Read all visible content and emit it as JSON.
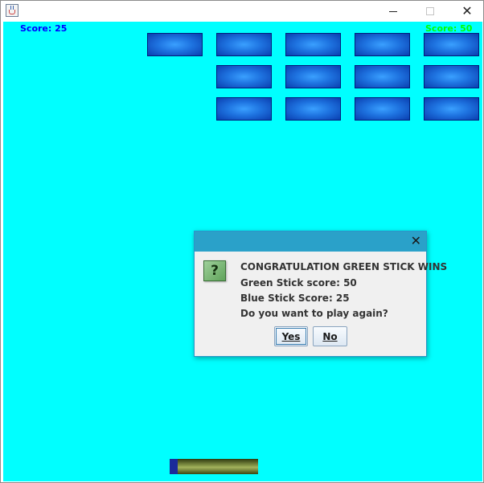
{
  "window": {
    "icon": "java-cup-icon",
    "controls": {
      "minimize": "minimize-icon",
      "maximize": "maximize-icon",
      "close": "✕"
    }
  },
  "game": {
    "background": "#00ffff",
    "blue_score": "Score:  25",
    "green_score": "Score:  50",
    "brick_color": "#1e73e0",
    "paddle_color": "#8a9a4a"
  },
  "dialog": {
    "close": "✕",
    "icon": "?",
    "lines": [
      "CONGRATULATION GREEN STICK WINS",
      "Green Stick score: 50",
      "Blue Stick Score: 25",
      "Do you want to play again?"
    ],
    "buttons": {
      "yes": "Yes",
      "no": "No"
    }
  }
}
